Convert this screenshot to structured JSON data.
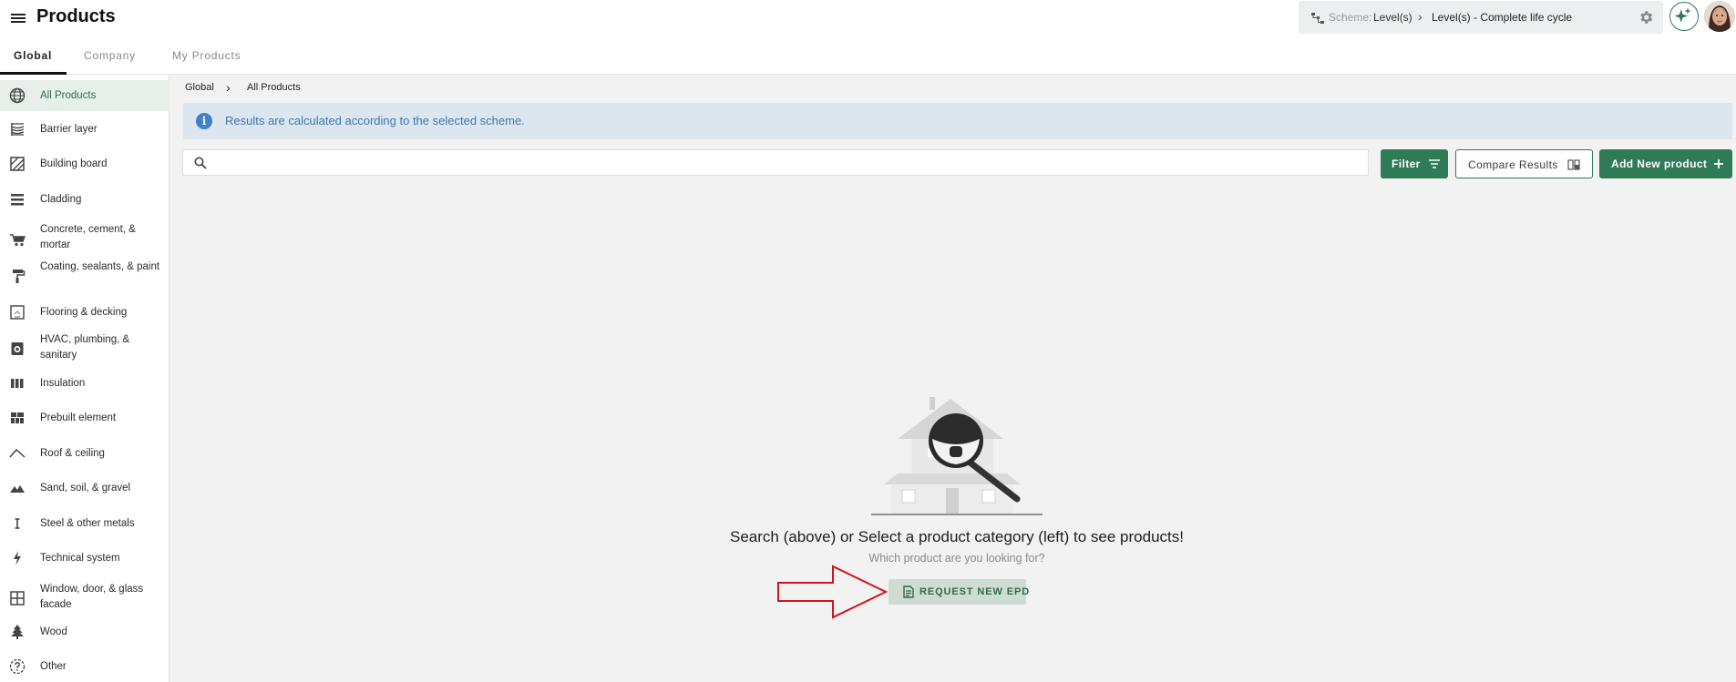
{
  "header": {
    "title": "Products",
    "scheme_label": "Scheme:",
    "scheme_level": "Level(s)",
    "scheme_cycle": "Level(s) - Complete life cycle"
  },
  "tabs": [
    {
      "label": "Global",
      "active": true
    },
    {
      "label": "Company",
      "active": false
    },
    {
      "label": "My Products",
      "active": false
    }
  ],
  "sidebar": {
    "items": [
      {
        "label": "All Products",
        "icon": "globe-icon",
        "active": true
      },
      {
        "label": "Barrier layer",
        "icon": "barrier-layer-icon"
      },
      {
        "label": "Building board",
        "icon": "building-board-icon"
      },
      {
        "label": "Cladding",
        "icon": "cladding-icon"
      },
      {
        "label": "Concrete, cement, & mortar",
        "icon": "wheelbarrow-icon"
      },
      {
        "label": "Coating, sealants, & paint",
        "icon": "paint-roller-icon"
      },
      {
        "label": "Flooring & decking",
        "icon": "flooring-icon"
      },
      {
        "label": "HVAC, plumbing, & sanitary",
        "icon": "hvac-icon"
      },
      {
        "label": "Insulation",
        "icon": "insulation-icon"
      },
      {
        "label": "Prebuilt element",
        "icon": "prebuilt-element-icon"
      },
      {
        "label": "Roof & ceiling",
        "icon": "roof-icon"
      },
      {
        "label": "Sand, soil, & gravel",
        "icon": "terrain-icon"
      },
      {
        "label": "Steel & other metals",
        "icon": "steel-beam-icon"
      },
      {
        "label": "Technical system",
        "icon": "lightning-icon"
      },
      {
        "label": "Window, door, & glass facade",
        "icon": "window-icon"
      },
      {
        "label": "Wood",
        "icon": "tree-icon"
      },
      {
        "label": "Other",
        "icon": "question-icon"
      }
    ]
  },
  "breadcrumb": {
    "root": "Global",
    "separator": "›",
    "current": "All Products"
  },
  "info": {
    "text": "Results are calculated according to the selected scheme."
  },
  "search": {
    "value": "",
    "placeholder": ""
  },
  "actions": {
    "filter_label": "Filter",
    "compare_label": "Compare Results",
    "add_label": "Add New product"
  },
  "empty_state": {
    "title": "Search (above) or Select a product category (left) to see products!",
    "subtitle": "Which product are you looking for?",
    "request_label": "REQUEST NEW EPD"
  },
  "colors": {
    "primary_green": "#2f7a57",
    "info_bg": "#dce6ee",
    "info_text": "#3a78b6",
    "annotation_arrow": "#d0141c"
  }
}
